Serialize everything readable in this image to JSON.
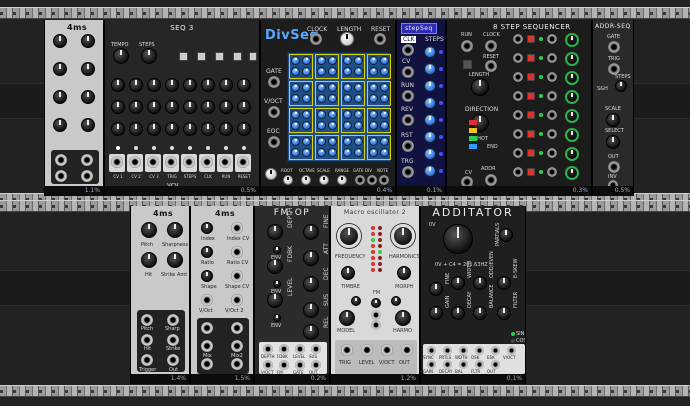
{
  "rack": {
    "row1": {
      "modules": [
        {
          "name": "4ms-clock-module",
          "cpu": "1.1%",
          "labels": [
            "Slew",
            "Out"
          ]
        },
        {
          "name": "seq3",
          "title": "SEQ 3",
          "cpu": "0.5%",
          "top_labels": [
            "TEMPO",
            "STEPS",
            "TEMPO",
            "STEPS",
            "CLK",
            "RUN",
            "RESET"
          ],
          "jack_labels": [
            "CV 1",
            "CV 2",
            "CV 3",
            "TRIG",
            "STEPS",
            "CLK",
            "RUN",
            "RESET"
          ],
          "brand": "VCV"
        },
        {
          "name": "divseq",
          "title": "DivSeq",
          "cpu": "0.4%",
          "top_labels": [
            "CLOCK",
            "LENGTH",
            "RESET"
          ],
          "side_labels": [
            "GATE",
            "V/OCT",
            "EOC"
          ],
          "bottom_labels": [
            "ROOT",
            "OCTAVE",
            "SCALE",
            "RANGE",
            "GATE",
            "DIV",
            "NOTE"
          ]
        },
        {
          "name": "stepseq",
          "title": "stepSeq",
          "cpu": "0.1%",
          "labels": [
            "CLK",
            "STEPS",
            "CV",
            "RUN",
            "REV",
            "RST",
            "TRG"
          ]
        },
        {
          "name": "8-step-sequencer",
          "title": "8 STEP SEQUENCER",
          "cpu": "0.3%",
          "labels": [
            "RUN",
            "CLOCK",
            "RESET",
            "LENGTH",
            "DIRECTION",
            "1-SHOT",
            "END",
            "ADDR",
            "CV"
          ]
        },
        {
          "name": "addr-seq",
          "title": "ADDR-SEQ",
          "cpu": "0.5%",
          "labels": [
            "GATE",
            "TRIG",
            "S&H",
            "SCALE",
            "OUT",
            "INV",
            "STEPS",
            "SELECT"
          ]
        }
      ]
    },
    "row2": {
      "modules": [
        {
          "name": "4ms-pitch-module",
          "cpu": "1.4%",
          "labels": [
            "Pitch",
            "Sharpness",
            "Hit",
            "Strike Amt",
            "Pitch",
            "Sharp",
            "Hit",
            "Strike",
            "Trigger",
            "Out"
          ]
        },
        {
          "name": "4ms-index-module",
          "cpu": "1.5%",
          "labels": [
            "Index",
            "Index CV",
            "Ratio",
            "Ratio CV",
            "Shape",
            "Shape CV",
            "V/Oct",
            "V/Oct 2",
            "Mix",
            "Mix2"
          ]
        },
        {
          "name": "fm-op",
          "title": "FM-OP",
          "cpu": "0.2%",
          "labels": [
            "DEPTH",
            "FDBK",
            "LEVEL",
            "ATT",
            "DEC",
            "SUS",
            "REL",
            "FINE",
            "ENV",
            "ENV",
            "ENV"
          ],
          "jack_labels": [
            "DEPTH",
            "FDBK",
            "LEVEL",
            "SUS",
            "V/OCT",
            "FM",
            "GATE",
            "OUT"
          ]
        },
        {
          "name": "macro-oscillator-2",
          "title": "Macro oscillator 2",
          "cpu": "1.2%",
          "labels": [
            "FREQUENCY",
            "HARMONICS",
            "TIMBRE",
            "FM",
            "MORPH",
            "MODEL",
            "HARMO"
          ],
          "jack_labels": [
            "TRIG",
            "LEVEL",
            "V/OCT",
            "OUT"
          ]
        },
        {
          "name": "additator",
          "title": "ADDITATOR",
          "cpu": "0.1%",
          "labels": [
            "0V",
            "0V + C4 = 261.63HZ",
            "PARTIALS",
            "FINE",
            "WIDTH",
            "ODD/EVEN",
            "E-SKEW",
            "GAIN",
            "DECAY",
            "BALANCE",
            "FILTER"
          ],
          "jack_labels": [
            "SYNC",
            "PRTLS",
            "WDTH",
            "OSK",
            "ESK",
            "V/OCT",
            "GAIN",
            "DECAY",
            "BAL",
            "FLTR",
            "OUT"
          ],
          "mode_labels": [
            "SIN",
            "COS"
          ]
        }
      ]
    }
  },
  "colors": {
    "led_green": "#2bd14a",
    "led_red": "#e0312f",
    "led_blue": "#2f9bff",
    "led_yellow": "#f2c320"
  }
}
